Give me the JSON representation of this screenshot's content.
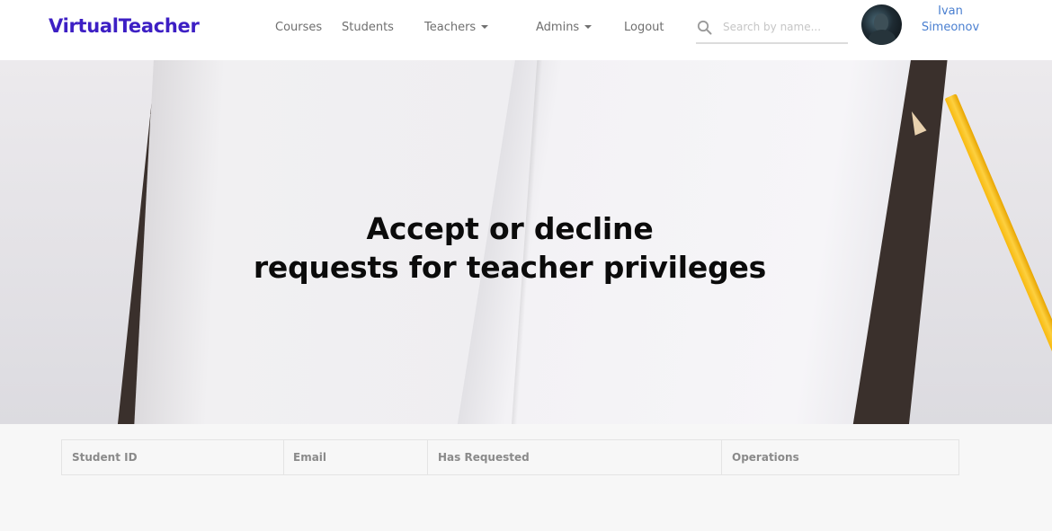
{
  "navbar": {
    "brand": "VirtualTeacher",
    "links": [
      {
        "label": "Courses"
      },
      {
        "label": "Students"
      },
      {
        "label": "Teachers",
        "dropdown": true
      },
      {
        "label": "Admins",
        "dropdown": true
      },
      {
        "label": "Logout"
      }
    ],
    "search": {
      "placeholder": "Search by name...",
      "value": ""
    },
    "user": {
      "first_name": "Ivan",
      "last_name": "Simeonov"
    }
  },
  "hero": {
    "title_line1": "Accept or decline",
    "title_line2": "requests for teacher privileges"
  },
  "table": {
    "columns": [
      "Student ID",
      "Email",
      "Has Requested",
      "Operations"
    ],
    "rows": []
  },
  "colors": {
    "brand": "#3d1fc4",
    "nav_text": "#6f6f6f",
    "user_link": "#4a7fd0",
    "pencil": "#fdc21e"
  }
}
